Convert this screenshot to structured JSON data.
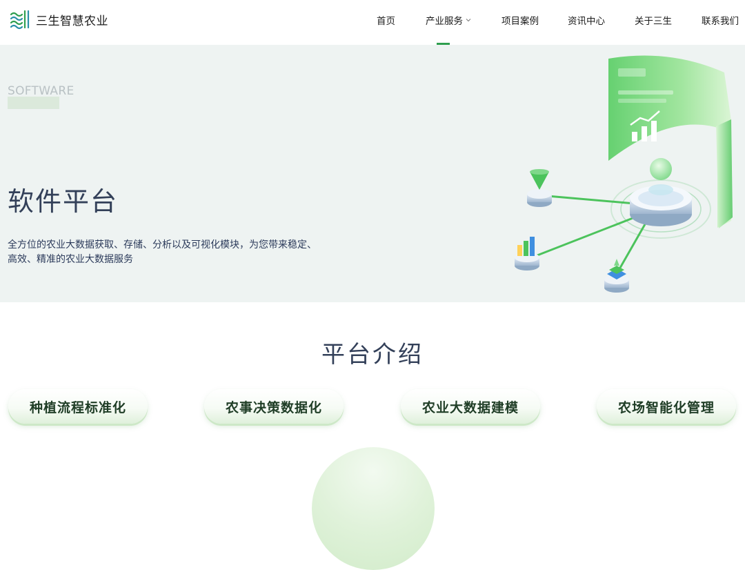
{
  "brand": {
    "name": "三生智慧农业",
    "accent": "#2e9e4f"
  },
  "nav": {
    "items": [
      {
        "label": "首页"
      },
      {
        "label": "产业服务",
        "has_dropdown": true
      },
      {
        "label": "项目案例"
      },
      {
        "label": "资讯中心"
      },
      {
        "label": "关于三生"
      },
      {
        "label": "联系我们"
      }
    ],
    "active_index": 1
  },
  "hero": {
    "watermark": "SOFTWARE",
    "title": "软件平台",
    "description": "全方位的农业大数据获取、存储、分析以及可视化模块，为您带来稳定、高效、精准的农业大数据服务",
    "illustration_icon": "data-platform-illustration"
  },
  "intro": {
    "title": "平台介绍",
    "features": [
      {
        "label": "种植流程标准化"
      },
      {
        "label": "农事决策数据化"
      },
      {
        "label": "农业大数据建模"
      },
      {
        "label": "农场智能化管理"
      }
    ]
  }
}
